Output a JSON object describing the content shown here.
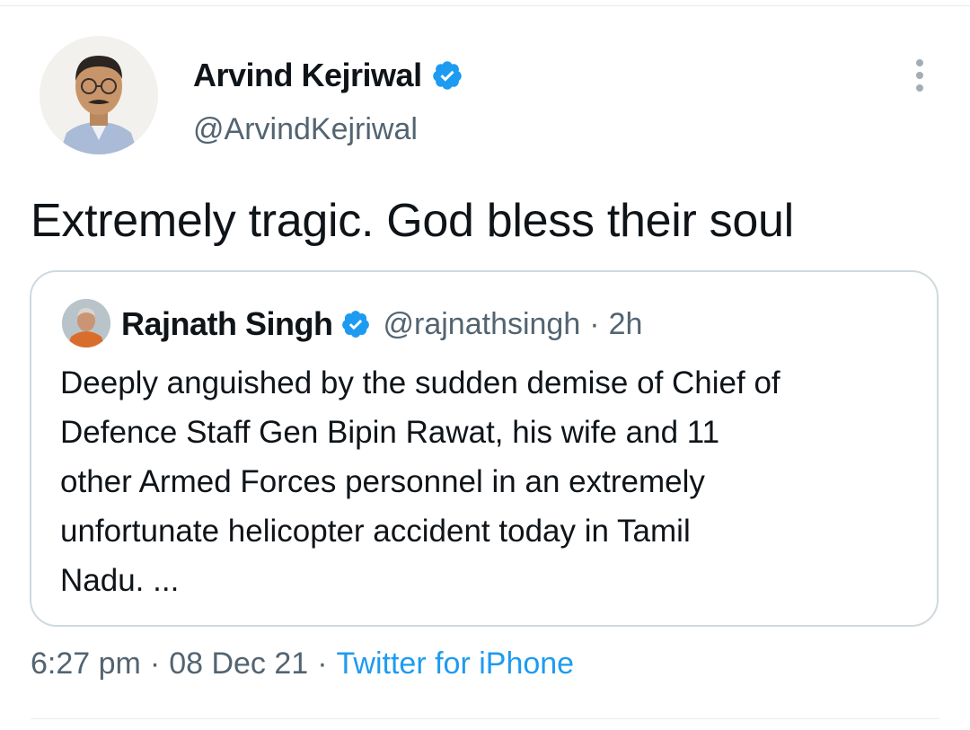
{
  "tweet": {
    "author": {
      "display_name": "Arvind Kejriwal",
      "handle": "@ArvindKejriwal",
      "verified": true,
      "avatar_icon": "profile-photo"
    },
    "text": "Extremely tragic. God bless their soul",
    "more_icon": "more-vertical-icon"
  },
  "quoted_tweet": {
    "author": {
      "display_name": "Rajnath Singh",
      "handle": "@rajnathsingh",
      "verified": true,
      "avatar_icon": "profile-photo"
    },
    "separator": "·",
    "time": "2h",
    "text": "Deeply anguished by the sudden demise of Chief of\nDefence Staff Gen Bipin Rawat, his wife and 11\nother Armed Forces personnel in an extremely\nunfortunate helicopter accident today in Tamil\nNadu. ..."
  },
  "meta": {
    "time": "6:27 pm",
    "separator_1": "·",
    "date": "08 Dec 21",
    "separator_2": "·",
    "source": "Twitter for iPhone"
  },
  "colors": {
    "accent": "#1d9bf0",
    "secondary_text": "#536471",
    "border": "#cfd9de",
    "primary_text": "#0f1419"
  }
}
